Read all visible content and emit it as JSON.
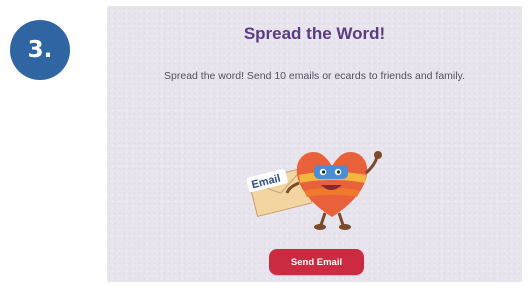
{
  "step": {
    "label": "3."
  },
  "card": {
    "title": "Spread the Word!",
    "description": "Spread the word! Send 10 emails or ecards to friends and family.",
    "button_label": "Send Email",
    "envelope_label": "Email"
  },
  "colors": {
    "step_badge": "#2f65a3",
    "title": "#5b3c82",
    "button": "#cc2a40",
    "card_background": "#e8e4ee"
  },
  "icons": {
    "mascot": "heart-mascot-icon",
    "envelope": "envelope-icon"
  }
}
